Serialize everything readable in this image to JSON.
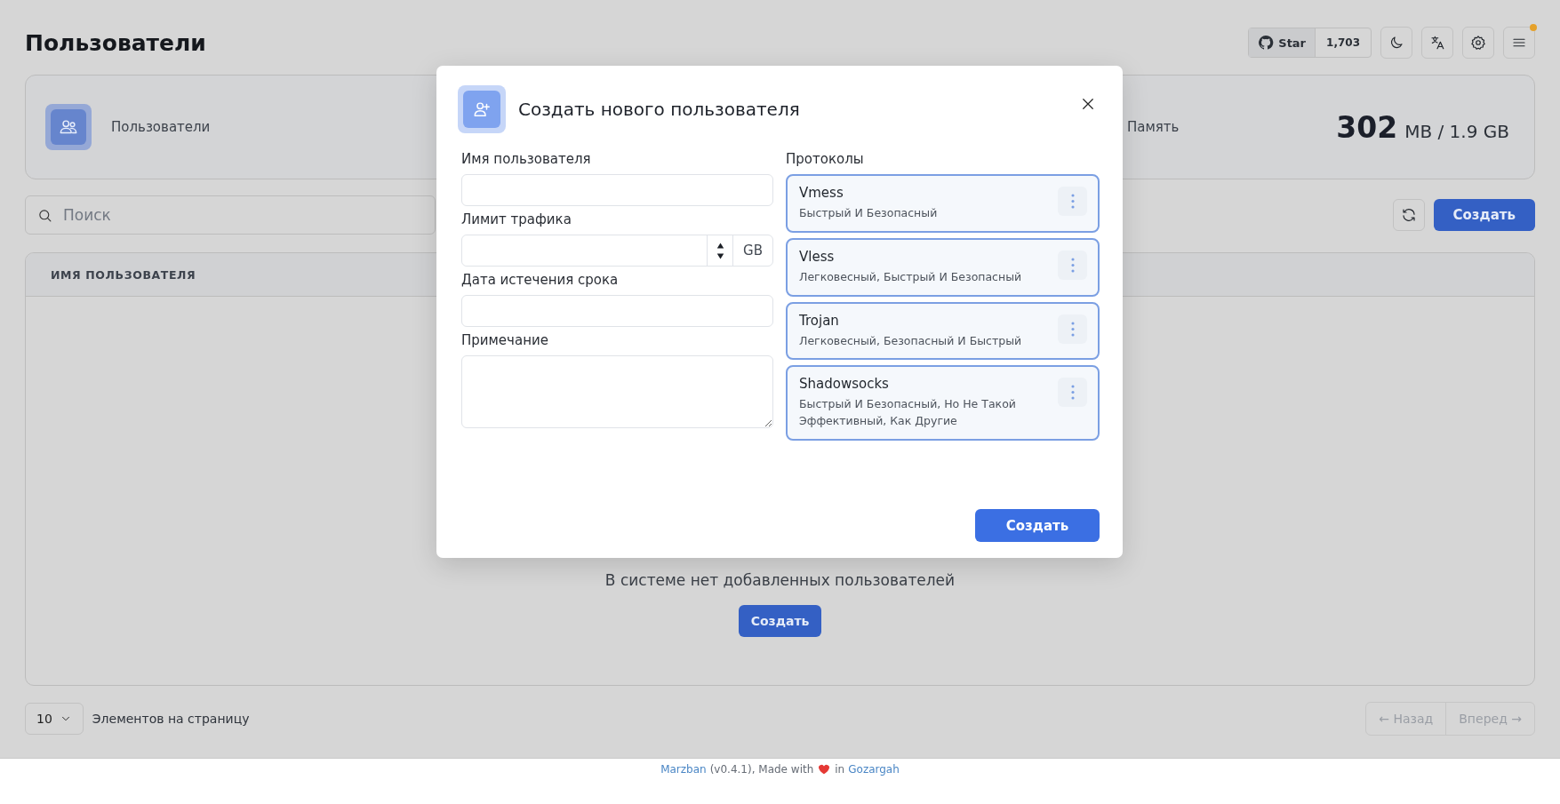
{
  "page": {
    "title": "Пользователи"
  },
  "header": {
    "github_label": "Star",
    "github_count": "1,703",
    "menu_badge": true
  },
  "stats": [
    {
      "label": "Пользователи"
    },
    {
      "label": "Память",
      "value": "302",
      "unit": "MB / 1.9 GB"
    }
  ],
  "search": {
    "placeholder": "Поиск"
  },
  "toolbar": {
    "create_label": "Создать"
  },
  "table": {
    "columns": [
      "ИМЯ ПОЛЬЗОВАТЕЛЯ"
    ],
    "empty_text": "В системе нет добавленных пользователей",
    "empty_button": "Создать"
  },
  "pagination": {
    "page_size": "10",
    "page_size_label": "Элементов на страницу",
    "prev": "← Назад",
    "next": "Вперед →",
    "prev_disabled": true,
    "next_disabled": true
  },
  "footer": {
    "project_link": "Marzban",
    "made_with": "(v0.4.1), Made with",
    "in_text": "in",
    "author_link": "Gozargah"
  },
  "modal": {
    "title": "Создать нового пользователя",
    "fields": [
      {
        "kind": "text",
        "label": "Имя пользователя"
      },
      {
        "kind": "number",
        "label": "Лимит трафика",
        "unit": "GB"
      },
      {
        "kind": "text",
        "label": "Дата истечения срока"
      },
      {
        "kind": "textarea",
        "label": "Примечание"
      }
    ],
    "protocols_label": "Протоколы",
    "protocols": [
      {
        "name": "Vmess",
        "description": "Быстрый И Безопасный",
        "selected": true
      },
      {
        "name": "Vless",
        "description": "Легковесный, Быстрый И Безопасный",
        "selected": true
      },
      {
        "name": "Trojan",
        "description": "Легковесный, Безопасный И Быстрый",
        "selected": true
      },
      {
        "name": "Shadowsocks",
        "description": "Быстрый И Безопасный, Но Не Такой Эффективный, Как Другие",
        "selected": true
      }
    ],
    "submit": "Создать"
  }
}
